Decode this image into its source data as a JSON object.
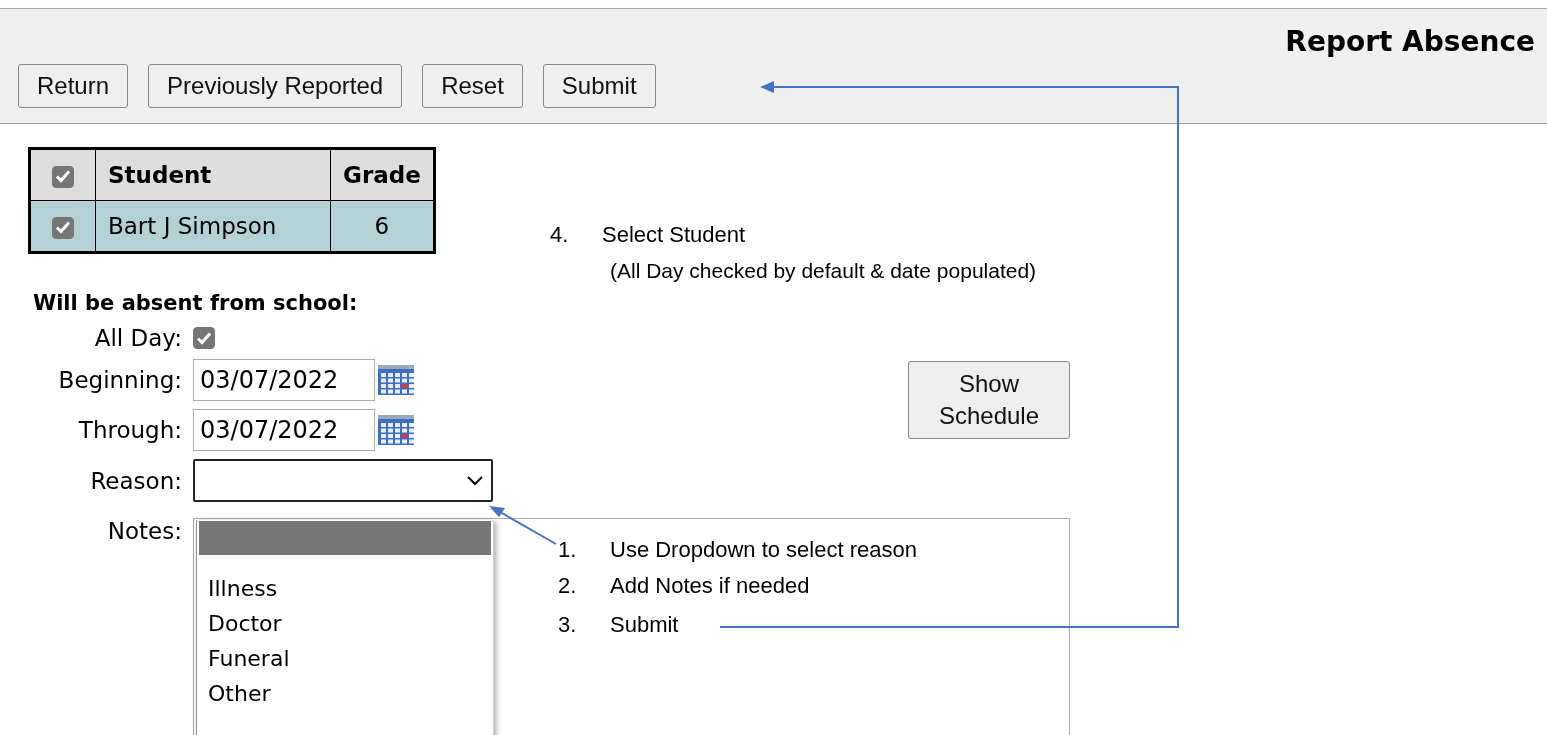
{
  "header": {
    "title": "Report Absence",
    "buttons": [
      "Return",
      "Previously Reported",
      "Reset",
      "Submit"
    ]
  },
  "students": {
    "header_checked": true,
    "columns": [
      "Student",
      "Grade"
    ],
    "rows": [
      {
        "checked": true,
        "selected": true,
        "student": "Bart J Simpson",
        "grade": "6"
      }
    ]
  },
  "form": {
    "heading": "Will be absent from school:",
    "all_day": {
      "label": "All Day:",
      "checked": true
    },
    "beginning": {
      "label": "Beginning:",
      "value": "03/07/2022"
    },
    "through": {
      "label": "Through:",
      "value": "03/07/2022"
    },
    "reason": {
      "label": "Reason:",
      "expanded": true,
      "blank_option_selected": true,
      "options": [
        {
          "label": "Illness",
          "selected": false
        },
        {
          "label": "Doctor",
          "selected": false
        },
        {
          "label": "Funeral",
          "selected": false
        },
        {
          "label": "Other",
          "selected": false
        }
      ]
    },
    "notes": {
      "label": "Notes:"
    },
    "show_schedule": "Show Schedule"
  },
  "annotations": [
    {
      "number": "4.",
      "text": "Select Student",
      "note": "(All Day checked by default & date populated)"
    },
    {
      "number": "1.",
      "text": "Use Dropdown to select reason"
    },
    {
      "number": "2.",
      "text": "Add Notes if needed"
    },
    {
      "number": "3.",
      "text": "Submit"
    }
  ]
}
